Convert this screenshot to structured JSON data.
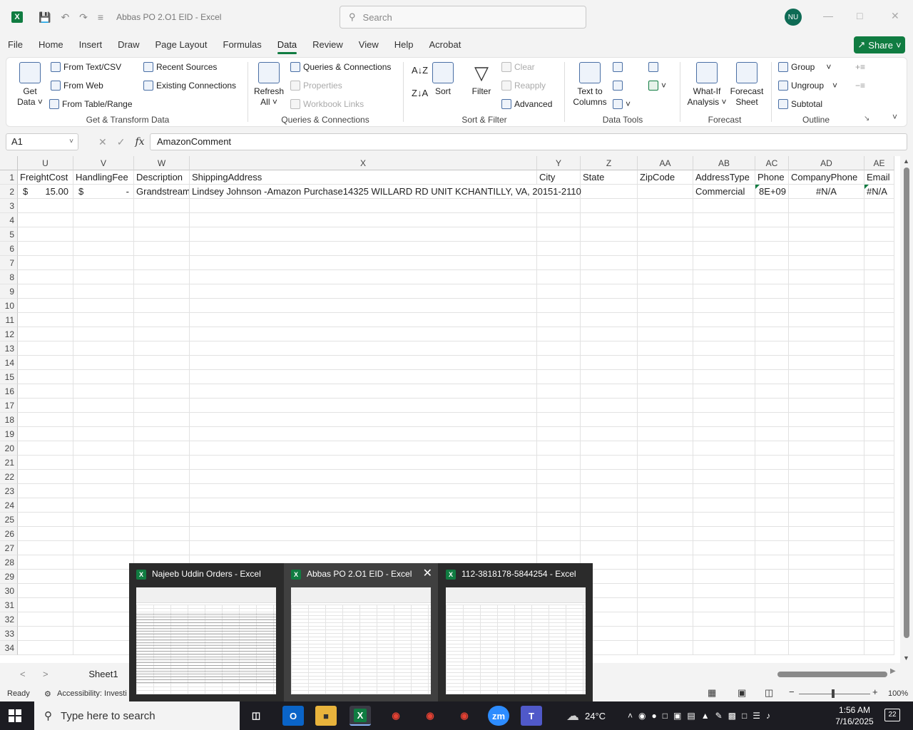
{
  "app": {
    "title": "Abbas PO 2.O1  EID  -  Excel",
    "search_placeholder": "Search",
    "avatar_initials": "NU",
    "share_label": "Share"
  },
  "tabs": [
    "File",
    "Home",
    "Insert",
    "Draw",
    "Page Layout",
    "Formulas",
    "Data",
    "Review",
    "View",
    "Help",
    "Acrobat"
  ],
  "active_tab": "Data",
  "ribbon": {
    "get_data_1": "Get",
    "get_data_2": "Data",
    "from_text_csv": "From Text/CSV",
    "from_web": "From Web",
    "from_table_range": "From Table/Range",
    "recent_sources": "Recent Sources",
    "existing_connections": "Existing Connections",
    "group_get_transform": "Get & Transform Data",
    "refresh_1": "Refresh",
    "refresh_2": "All",
    "queries_connections": "Queries & Connections",
    "properties": "Properties",
    "workbook_links": "Workbook Links",
    "group_queries": "Queries & Connections",
    "sort": "Sort",
    "filter": "Filter",
    "clear": "Clear",
    "reapply": "Reapply",
    "advanced": "Advanced",
    "group_sort_filter": "Sort & Filter",
    "text_to_1": "Text to",
    "text_to_2": "Columns",
    "group_data_tools": "Data Tools",
    "whatif_1": "What-If",
    "whatif_2": "Analysis",
    "forecast_1": "Forecast",
    "forecast_2": "Sheet",
    "group_forecast": "Forecast",
    "group": "Group",
    "ungroup": "Ungroup",
    "subtotal": "Subtotal",
    "group_outline": "Outline"
  },
  "formula_bar": {
    "name_box": "A1",
    "formula": "AmazonComment"
  },
  "columns": [
    {
      "letter": "U",
      "header": "FreightCost"
    },
    {
      "letter": "V",
      "header": "HandlingFee"
    },
    {
      "letter": "W",
      "header": "Description"
    },
    {
      "letter": "X",
      "header": "ShippingAddress"
    },
    {
      "letter": "Y",
      "header": "City"
    },
    {
      "letter": "Z",
      "header": "State"
    },
    {
      "letter": "AA",
      "header": "ZipCode"
    },
    {
      "letter": "AB",
      "header": "AddressType"
    },
    {
      "letter": "AC",
      "header": "Phone"
    },
    {
      "letter": "AD",
      "header": "CompanyPhone"
    },
    {
      "letter": "AE",
      "header": "Email"
    }
  ],
  "row2": {
    "freight_currency": "$",
    "freight_amount": "15.00",
    "handling_currency": "$",
    "handling_amount": "-",
    "description": "Grandstream",
    "shipping_address": "Lindsey Johnson -Amazon Purchase14325 WILLARD RD UNIT KCHANTILLY, VA, 20151-2110",
    "address_type": "Commercial",
    "phone": "8E+09",
    "company_phone": "#N/A",
    "email": "#N/A"
  },
  "row_numbers": [
    "1",
    "2",
    "3",
    "4",
    "5",
    "6",
    "7",
    "8",
    "9",
    "10",
    "11",
    "12",
    "13",
    "14",
    "15",
    "16",
    "17",
    "18",
    "19",
    "20",
    "21",
    "22",
    "23",
    "24",
    "25",
    "26",
    "27",
    "28",
    "29",
    "30",
    "31",
    "32",
    "33",
    "34"
  ],
  "sheet_tab": "Sheet1",
  "status": {
    "ready": "Ready",
    "accessibility": "Accessibility: Investi",
    "zoom": "100%"
  },
  "thumbnails": [
    {
      "title": "Najeeb Uddin Orders - Excel"
    },
    {
      "title": "Abbas PO 2.O1  EID - Excel"
    },
    {
      "title": "112-3818178-5844254 - Excel"
    }
  ],
  "taskbar": {
    "search_placeholder": "Type here to search",
    "weather": "24°C",
    "time": "1:56 AM",
    "date": "7/16/2025",
    "notifications": "22"
  }
}
